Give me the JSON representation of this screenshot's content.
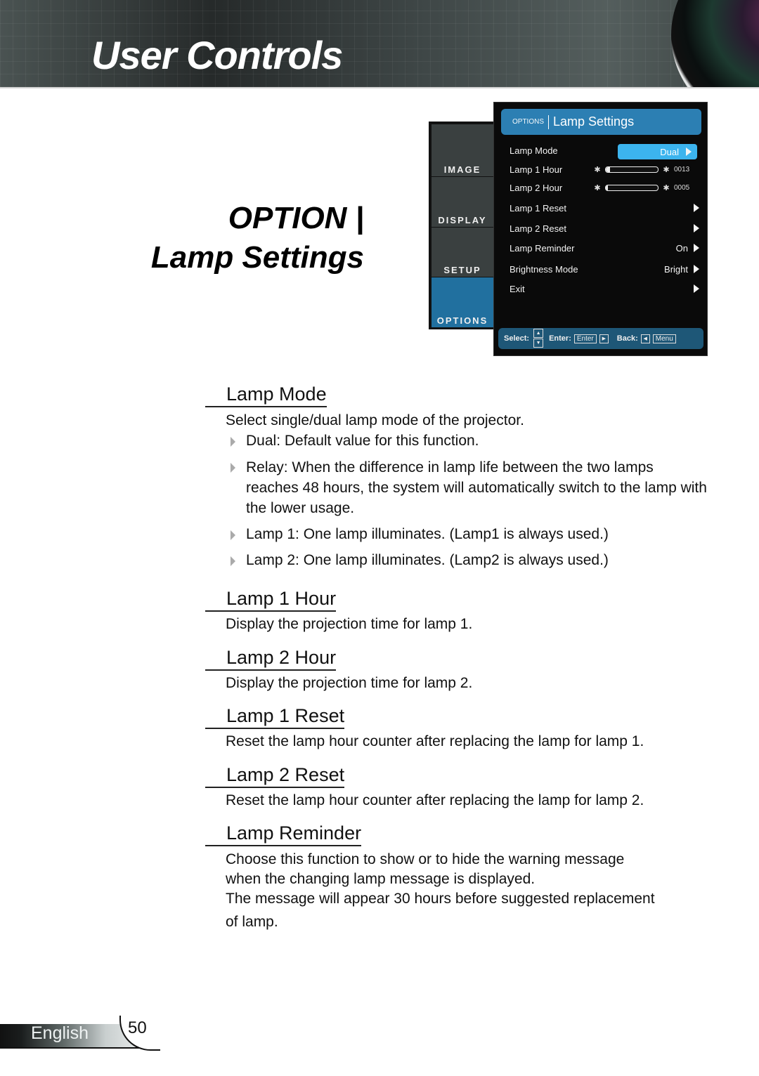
{
  "header": {
    "title": "User Controls"
  },
  "section": {
    "line1": "OPTION |",
    "line2": "Lamp Settings"
  },
  "osd": {
    "tabs": [
      {
        "label": "IMAGE",
        "active": false
      },
      {
        "label": "DISPLAY",
        "active": false
      },
      {
        "label": "SETUP",
        "active": false
      },
      {
        "label": "OPTIONS",
        "active": true
      }
    ],
    "header_small": "OPTIONS",
    "header_title": "Lamp Settings",
    "rows": [
      {
        "label": "Lamp Mode",
        "value": "Dual"
      },
      {
        "label": "Lamp 1 Hour",
        "hours": "0013",
        "progress": 0.08
      },
      {
        "label": "Lamp 2 Hour",
        "hours": "0005",
        "progress": 0.04
      },
      {
        "label": "Lamp 1 Reset",
        "value": ""
      },
      {
        "label": "Lamp 2 Reset",
        "value": ""
      },
      {
        "label": "Lamp Reminder",
        "value": "On"
      },
      {
        "label": "Brightness Mode",
        "value": "Bright"
      },
      {
        "label": "Exit",
        "value": ""
      }
    ],
    "footer": {
      "select_label": "Select:",
      "enter_label": "Enter:",
      "enter_key": "Enter",
      "back_label": "Back:",
      "menu_key": "Menu"
    },
    "colors": {
      "accent": "#2c7fb3",
      "highlight": "#3cb4ee",
      "active_tab": "#21709f",
      "footer": "#1e5777"
    }
  },
  "content": {
    "lamp_mode": {
      "heading": "Lamp Mode",
      "intro": "Select single/dual lamp mode of the projector.",
      "bullets": [
        "Dual: Default value for this function.",
        "Relay: When the difference in lamp life between the two lamps reaches 48 hours, the system will automatically switch to the lamp with the lower usage.",
        "Lamp 1: One lamp illuminates. (Lamp1 is always used.)",
        "Lamp 2: One lamp illuminates. (Lamp2 is always used.)"
      ]
    },
    "lamp1_hour": {
      "heading": "Lamp 1 Hour",
      "text": "Display the projection time for lamp 1."
    },
    "lamp2_hour": {
      "heading": "Lamp 2 Hour",
      "text": "Display the projection time for lamp 2."
    },
    "lamp1_reset": {
      "heading": "Lamp 1 Reset",
      "text": "Reset the lamp hour counter after replacing the lamp for lamp 1."
    },
    "lamp2_reset": {
      "heading": "Lamp 2 Reset",
      "text": "Reset the lamp hour counter after replacing the lamp for lamp 2."
    },
    "lamp_reminder": {
      "heading": "Lamp Reminder",
      "line1": "Choose this function to show or to hide the warning message",
      "line2": "when the changing lamp message is displayed.",
      "line3": "The message will appear 30 hours before suggested replacement",
      "line4": "of lamp."
    }
  },
  "footer": {
    "language": "English",
    "page": "50"
  }
}
